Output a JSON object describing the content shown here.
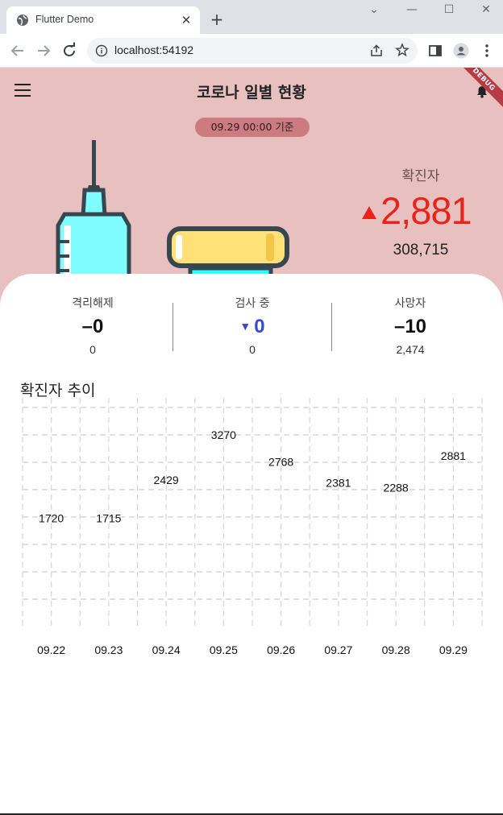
{
  "browser": {
    "tab_title": "Flutter Demo",
    "url": "localhost:54192"
  },
  "app": {
    "title": "코로나 일별 현황",
    "date_badge": "09.29 00:00 기준",
    "debug_label": "DEBUG"
  },
  "confirmed": {
    "label": "확진자",
    "change": "2,881",
    "total": "308,715"
  },
  "stats": [
    {
      "label": "격리해제",
      "change": "0",
      "total": "0",
      "direction": "none"
    },
    {
      "label": "검사 중",
      "change": "0",
      "total": "0",
      "direction": "down"
    },
    {
      "label": "사망자",
      "change": "10",
      "total": "2,474",
      "direction": "none"
    }
  ],
  "trend": {
    "title": "확진자 추이"
  },
  "colors": {
    "hero_bg": "#e8c0c0",
    "pill_bg": "#cc7c80",
    "confirmed_red": "#e8241a",
    "down_blue": "#3a4bc8",
    "bar_top": "#d6368f",
    "bar_mid": "#b34ee0",
    "bar_bottom": "#2dbde0"
  },
  "chart_data": {
    "type": "bar",
    "categories": [
      "09.22",
      "09.23",
      "09.24",
      "09.25",
      "09.26",
      "09.27",
      "09.28",
      "09.29"
    ],
    "values": [
      1720,
      1715,
      2429,
      3270,
      2768,
      2381,
      2288,
      2881
    ],
    "ylim": [
      0,
      3270
    ],
    "grid": true,
    "data_labels": true
  }
}
